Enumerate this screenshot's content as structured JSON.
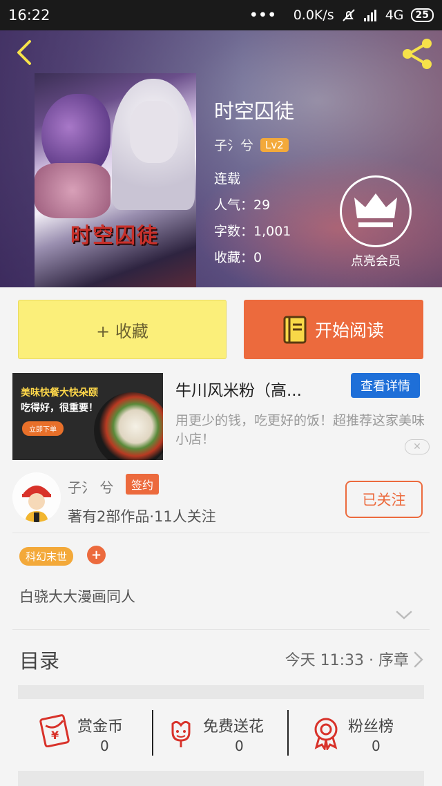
{
  "status_bar": {
    "time": "16:22",
    "dots": "•••",
    "net_speed": "0.0K/s",
    "signal": "4G",
    "battery": "25"
  },
  "book": {
    "title": "时空囚徒",
    "cover_title": "时空囚徒",
    "author": "子氵兮",
    "level": "Lv2",
    "status": "连载",
    "popularity": "人气：29",
    "word_count": "字数：1,001",
    "favorites": "收藏：0"
  },
  "vip": {
    "label": "点亮会员"
  },
  "buttons": {
    "collect": "+ 收藏",
    "read": "开始阅读"
  },
  "ad": {
    "image_line1": "美味快餐大快朵颐",
    "image_line2": "吃得好，很重要！",
    "image_button": "立即下单",
    "title": "牛川风米粉（高...",
    "detail_button": "查看详情",
    "description": "用更少的钱，吃更好的饭！超推荐这家美味小店！"
  },
  "author_card": {
    "name": "子氵 兮",
    "badge": "签约",
    "stats": "著有2部作品·11人关注",
    "follow_button": "已关注"
  },
  "tags": {
    "items": [
      "科幻末世"
    ],
    "add": "+"
  },
  "description": "白骁大大漫画同人",
  "toc": {
    "title": "目录",
    "latest": "今天 11:33 · 序章"
  },
  "actions": [
    {
      "label": "赏金币",
      "count": "0",
      "icon": "red-envelope-icon"
    },
    {
      "label": "免费送花",
      "count": "0",
      "icon": "flower-icon"
    },
    {
      "label": "粉丝榜",
      "count": "0",
      "icon": "medal-icon"
    }
  ],
  "colors": {
    "accent": "#ec6a3d",
    "collect_bg": "#fbef7a",
    "level_badge": "#f3a93a",
    "ad_button": "#1e6fd8"
  }
}
